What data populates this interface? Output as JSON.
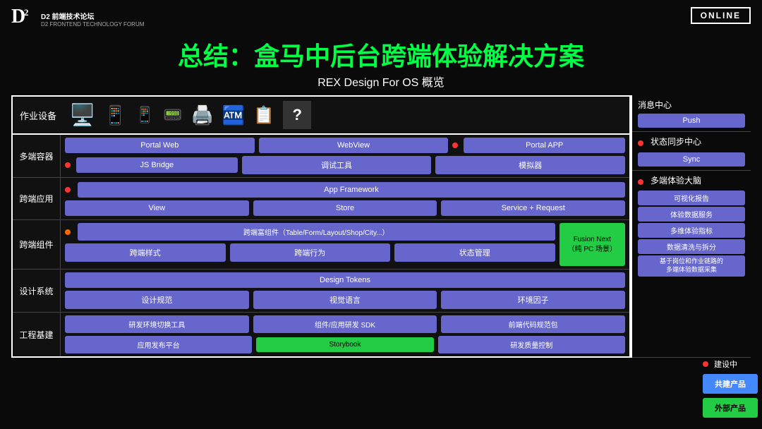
{
  "header": {
    "logo_d2": "D2",
    "logo_line1": "D2 前端技术论坛",
    "logo_line2": "D2 FRONTEND TECHNOLOGY FORUM",
    "online_badge": "ONLINE"
  },
  "title": {
    "main": "总结：盒马中后台跨端体验解决方案",
    "sub": "REX Design For OS 概览"
  },
  "device_row": {
    "label": "作业设备"
  },
  "sections": [
    {
      "label": "多端容器",
      "rows": [
        [
          "Portal Web",
          "WebView",
          "Portal APP"
        ],
        [
          "JS Bridge",
          "调试工具",
          "模拟器"
        ]
      ],
      "row1_dot": true,
      "row2_dot": true
    },
    {
      "label": "跨端应用",
      "rows": [
        [
          "App Framework"
        ],
        [
          "View",
          "Store",
          "Service + Request"
        ]
      ],
      "row1_dot": true,
      "row1_full": true
    },
    {
      "label": "跨端组件",
      "rows": [
        [
          "跨端富组件（Table/Form/Layout/Shop/City...）"
        ],
        [
          "跨端样式",
          "跨端行为",
          "状态管理"
        ]
      ],
      "row1_dot": true,
      "has_fusion": true,
      "fusion_label": "Fusion Next\n（纯 PC 场景）"
    },
    {
      "label": "设计系统",
      "rows": [
        [
          "Design Tokens"
        ],
        [
          "设计规范",
          "视觉语言",
          "环境因子"
        ]
      ],
      "row1_full": true
    },
    {
      "label": "工程基建",
      "rows": [
        [
          "研发环境切换工具",
          "组件/应用研发 SDK",
          "前端代码规范包"
        ],
        [
          "应用发布平台",
          "Storybook",
          "研发质量控制"
        ]
      ],
      "row2_storybook_green": true
    }
  ],
  "right_sections": [
    {
      "id": "msg",
      "title": "消息中心",
      "buttons": [
        "Push"
      ]
    },
    {
      "id": "sync",
      "title": "状态同步中心",
      "dot": true,
      "buttons": [
        "Sync"
      ]
    },
    {
      "id": "brain",
      "title": "多端体验大脑",
      "dot": true,
      "buttons": [
        "可视化报告",
        "体验数据服务",
        "多维体验指标",
        "数据清洗与拆分",
        "基于岗位和作业链路的多端体验数据采集"
      ]
    }
  ],
  "far_right": {
    "building_label": "建设中",
    "btn1": "共建产品",
    "btn2": "外部产品"
  }
}
